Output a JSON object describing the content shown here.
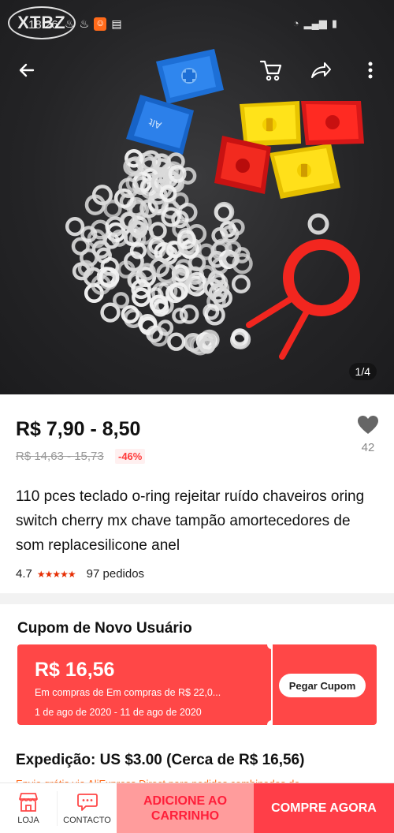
{
  "status_bar": {
    "watermark": "XTBZ",
    "time": "18:26"
  },
  "gallery": {
    "counter": "1/4"
  },
  "product": {
    "price": "R$ 7,90 - 8,50",
    "old_price": "R$ 14,63 - 15,73",
    "discount": "-46%",
    "wishlist_count": "42",
    "title": "110 pces teclado o-ring rejeitar ruído chaveiros oring switch cherry mx chave tampão amortecedores de som replacesilicone anel",
    "rating": "4.7",
    "stars": "★★★★★",
    "orders": "97 pedidos"
  },
  "coupon": {
    "heading": "Cupom de Novo Usuário",
    "amount": "R$ 16,56",
    "condition": "Em compras de Em compras de R$ 22,0...",
    "dates": "1 de ago de 2020 - 11 de ago de 2020",
    "button": "Pegar Cupom"
  },
  "shipping": {
    "label": "Expedição: US $3.00 (Cerca de R$ 16,56)",
    "note": "Envio grátis via AliExpress Direct para pedidos combinados de"
  },
  "bottom_bar": {
    "store_label": "LOJA",
    "contact_label": "CONTACTO",
    "add_to_cart": "ADICIONE AO CARRINHO",
    "buy_now": "COMPRE AGORA"
  },
  "colors": {
    "accent": "#ff4747",
    "buy": "#ff3e48",
    "cart_bg": "#ff9c9c",
    "star": "#e62e04"
  }
}
